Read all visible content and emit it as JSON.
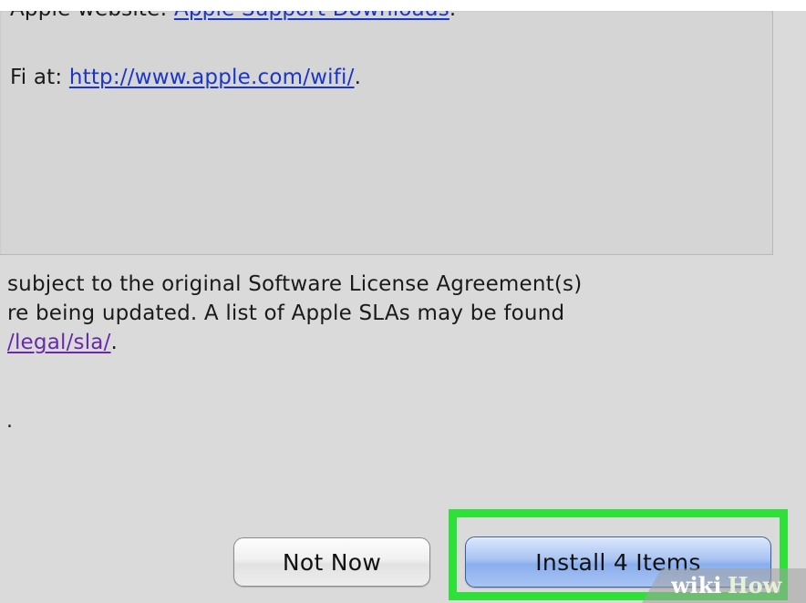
{
  "notes": {
    "line1_text": "Apple website: ",
    "line1_link": "Apple Support Downloads",
    "line1_suffix": ".",
    "line2_text": "Fi at: ",
    "line2_link": "http://www.apple.com/wifi/",
    "line2_suffix": "."
  },
  "license": {
    "line1": "subject to the original Software License Agreement(s)",
    "line2": "re being updated. A list of Apple SLAs may be found",
    "line3_link": "/legal/sla/",
    "line3_suffix": "."
  },
  "stray_dot": ".",
  "buttons": {
    "not_now_label": "Not Now",
    "install_label": "Install 4 Items"
  },
  "highlight_color": "#2fe03a",
  "watermark": {
    "text_part1": "wiki",
    "text_part2": "How"
  }
}
